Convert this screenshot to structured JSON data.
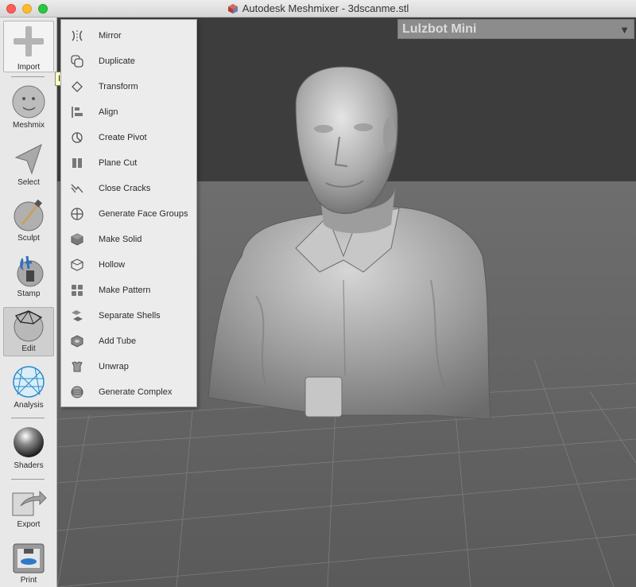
{
  "window": {
    "title": "Autodesk Meshmixer - 3dscanme.stl"
  },
  "printer": {
    "selected": "Lulzbot Mini"
  },
  "toolbar": {
    "tools": [
      {
        "label": "Import"
      },
      {
        "label": "Meshmix"
      },
      {
        "label": "Select"
      },
      {
        "label": "Sculpt"
      },
      {
        "label": "Stamp"
      },
      {
        "label": "Edit"
      },
      {
        "label": "Analysis"
      },
      {
        "label": "Shaders"
      },
      {
        "label": "Export"
      },
      {
        "label": "Print"
      }
    ],
    "active": "Edit"
  },
  "tooltip": {
    "text": "Import"
  },
  "edit_menu": {
    "items": [
      {
        "label": "Mirror",
        "icon": "mirror-icon"
      },
      {
        "label": "Duplicate",
        "icon": "duplicate-icon"
      },
      {
        "label": "Transform",
        "icon": "transform-icon"
      },
      {
        "label": "Align",
        "icon": "align-icon"
      },
      {
        "label": "Create Pivot",
        "icon": "pivot-icon"
      },
      {
        "label": "Plane Cut",
        "icon": "plane-cut-icon"
      },
      {
        "label": "Close Cracks",
        "icon": "close-cracks-icon"
      },
      {
        "label": "Generate Face Groups",
        "icon": "face-groups-icon"
      },
      {
        "label": "Make Solid",
        "icon": "make-solid-icon"
      },
      {
        "label": "Hollow",
        "icon": "hollow-icon"
      },
      {
        "label": "Make Pattern",
        "icon": "make-pattern-icon"
      },
      {
        "label": "Separate Shells",
        "icon": "separate-shells-icon"
      },
      {
        "label": "Add Tube",
        "icon": "add-tube-icon"
      },
      {
        "label": "Unwrap",
        "icon": "unwrap-icon"
      },
      {
        "label": "Generate Complex",
        "icon": "generate-complex-icon"
      }
    ]
  },
  "colors": {
    "viewport": "#5f5f5f",
    "background_wall": "#3c3c3c",
    "printer_bed": "#6a6a6a",
    "tooltip": "#ffffc8"
  }
}
